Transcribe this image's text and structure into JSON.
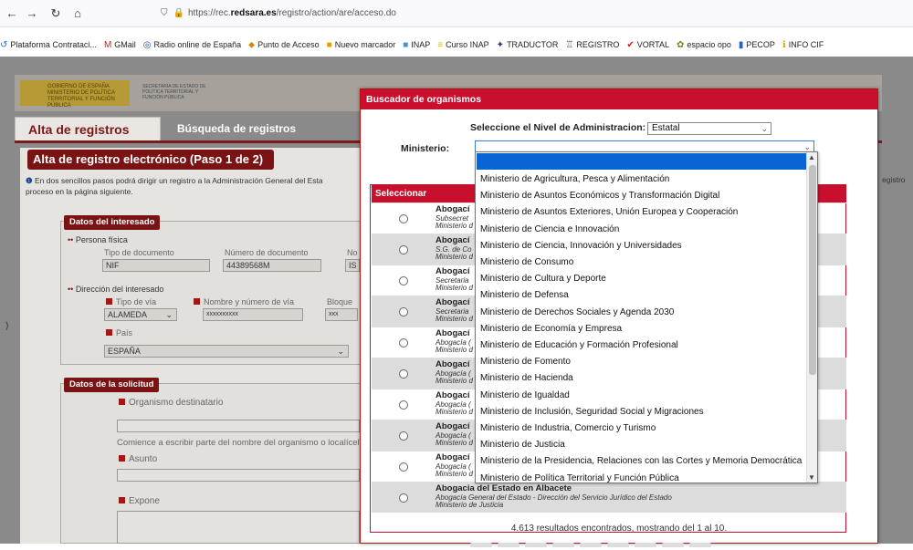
{
  "browser": {
    "back": "←",
    "forward": "→",
    "reload": "↻",
    "home": "⌂",
    "url_prefix": "https://rec.",
    "url_domain": "redsara.es",
    "url_path": "/registro/action/are/acceso.do"
  },
  "bookmarks": [
    {
      "icon": "↺",
      "label": "Plataforma Contrataci...",
      "color": "#1a73e8"
    },
    {
      "icon": "M",
      "label": "GMail",
      "color": "#c5221f"
    },
    {
      "icon": "◎",
      "label": "Radio online de España",
      "color": "#1a4fa0"
    },
    {
      "icon": "⬥",
      "label": "Punto de Acceso",
      "color": "#d28a00"
    },
    {
      "icon": "■",
      "label": "Nuevo marcador",
      "color": "#e0a000"
    },
    {
      "icon": "■",
      "label": "INAP",
      "color": "#4a90c8"
    },
    {
      "icon": "≡",
      "label": "Curso INAP",
      "color": "#d8c200"
    },
    {
      "icon": "✦",
      "label": "TRADUCTOR",
      "color": "#1a3a80"
    },
    {
      "icon": "♖",
      "label": "REGISTRO",
      "color": "#1a4fa0"
    },
    {
      "icon": "✔",
      "label": "VORTAL",
      "color": "#c5221f"
    },
    {
      "icon": "✿",
      "label": "espacio opo",
      "color": "#6a8a20"
    },
    {
      "icon": "▮",
      "label": "PECOP",
      "color": "#2a60c0"
    },
    {
      "icon": "ℹ",
      "label": "INFO CIF",
      "color": "#e0a000"
    }
  ],
  "header": {
    "gov_logo_text": "GOBIERNO DE ESPAÑA   MINISTERIO DE POLÍTICA TERRITORIAL Y FUNCIÓN PÚBLICA",
    "gov_logo2_text": "SECRETARÍA DE ESTADO DE POLÍTICA TERRITORIAL Y FUNCIÓN PÚBLICA"
  },
  "tabs": {
    "alta": "Alta de registros",
    "busqueda": "Búsqueda de registros"
  },
  "step_title": "Alta de registro electrónico (Paso 1 de 2)",
  "intro": {
    "icon": "❶",
    "text": "En dos sencillos pasos podrá dirigir un registro a la Administración General del Esta",
    "text2": "proceso en la página siguiente.",
    "right": "egistro"
  },
  "left_edge": ")",
  "interesado": {
    "title": "Datos del interesado",
    "persona": "Persona física",
    "tipo_doc_label": "Tipo de documento",
    "tipo_doc_value": "NIF",
    "num_doc_label": "Número de documento",
    "num_doc_value": "44389568M",
    "no_label": "No",
    "no_value": "IS",
    "direccion": "Dirección del interesado",
    "tipo_via_label": "Tipo de vía",
    "tipo_via_value": "ALAMEDA",
    "nombre_via_label": "Nombre y número de vía",
    "nombre_via_value": "xxxxxxxxxx",
    "bloque_label": "Bloque",
    "bloque_value": "xxx",
    "pais_label": "País",
    "pais_value": "ESPAÑA"
  },
  "solicitud": {
    "title": "Datos de la solicitud",
    "organismo_label": "Organismo destinatario",
    "organismo_hint": "Comience a escribir parte del nombre del organismo o localícelo",
    "asunto_label": "Asunto",
    "expone_label": "Expone"
  },
  "dialog": {
    "title": "Buscador de organismos",
    "nivel_label": "Seleccione el Nivel de Administracion:",
    "nivel_value": "Estatal",
    "ministerio_label": "Ministerio:",
    "ministerio_value": "",
    "col_header": "Seleccionar",
    "rows": [
      {
        "org": "Abogací",
        "l1": "Subsecret",
        "l2": "Ministerio d"
      },
      {
        "org": "Abogací",
        "l1": "S.G. de Co",
        "l2": "Ministerio d"
      },
      {
        "org": "Abogací",
        "l1": "Secretaria",
        "l2": "Ministerio d"
      },
      {
        "org": "Abogací",
        "l1": "Secretaria",
        "l2": "Ministerio d"
      },
      {
        "org": "Abogací",
        "l1": "Abogacía (",
        "l2": "Ministerio d"
      },
      {
        "org": "Abogací",
        "l1": "Abogacía (",
        "l2": "Ministerio d"
      },
      {
        "org": "Abogací",
        "l1": "Abogacía (",
        "l2": "Ministerio d"
      },
      {
        "org": "Abogací",
        "l1": "Abogacía (",
        "l2": "Ministerio d"
      },
      {
        "org": "Abogací",
        "l1": "Abogacía (",
        "l2": "Ministerio d"
      },
      {
        "org": "Abogacia del Estado en Albacete",
        "l1": "Abogacía General del Estado - Dirección del Servicio Jurídico del Estado",
        "l2": "Ministerio de Justicia"
      }
    ],
    "results": "4.613 resultados encontrados, mostrando del 1 al 10."
  },
  "dropdown": {
    "options": [
      "Ministerio de Agricultura, Pesca y Alimentación",
      "Ministerio de Asuntos Económicos y Transformación Digital",
      "Ministerio de Asuntos Exteriores, Unión Europea y Cooperación",
      "Ministerio de Ciencia e Innovación",
      "Ministerio de Ciencia, Innovación y Universidades",
      "Ministerio de Consumo",
      "Ministerio de Cultura y Deporte",
      "Ministerio de Defensa",
      "Ministerio de Derechos Sociales y Agenda 2030",
      "Ministerio de Economía y Empresa",
      "Ministerio de Educación y Formación Profesional",
      "Ministerio de Fomento",
      "Ministerio de Hacienda",
      "Ministerio de Igualdad",
      "Ministerio de Inclusión, Seguridad Social y Migraciones",
      "Ministerio de Industria, Comercio y Turismo",
      "Ministerio de Justicia",
      "Ministerio de la Presidencia, Relaciones con las Cortes y Memoria Democrática",
      "Ministerio de Política Territorial y Función Pública"
    ]
  },
  "colors": {
    "brand_red": "#c8102e",
    "dark_red": "#7a1414",
    "selection_blue": "#0a64d4"
  }
}
